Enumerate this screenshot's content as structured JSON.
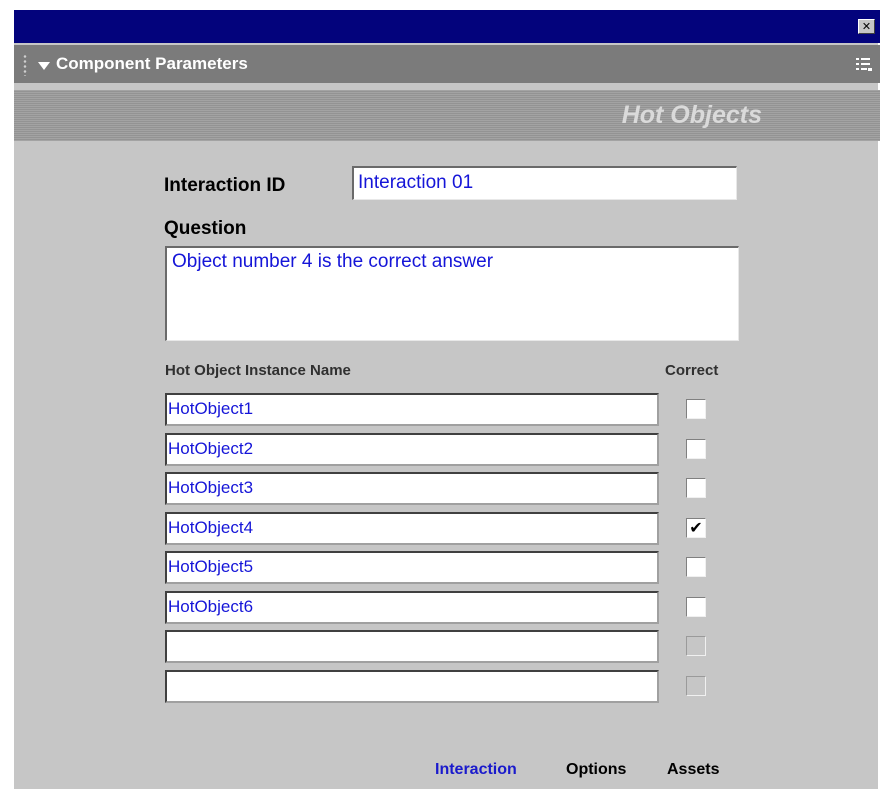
{
  "window": {
    "close_glyph": "✕"
  },
  "panel": {
    "title": "Component Parameters"
  },
  "header": {
    "title": "Hot Objects"
  },
  "form": {
    "interaction_id_label": "Interaction ID",
    "interaction_id_value": "Interaction  01",
    "question_label": "Question",
    "question_value": "Object number 4 is the correct answer",
    "instance_name_header": "Hot Object Instance Name",
    "correct_header": "Correct",
    "rows": [
      {
        "name": "HotObject1",
        "correct": false,
        "enabled": true
      },
      {
        "name": "HotObject2",
        "correct": false,
        "enabled": true
      },
      {
        "name": "HotObject3",
        "correct": false,
        "enabled": true
      },
      {
        "name": "HotObject4",
        "correct": true,
        "enabled": true
      },
      {
        "name": "HotObject5",
        "correct": false,
        "enabled": true
      },
      {
        "name": "HotObject6",
        "correct": false,
        "enabled": true
      },
      {
        "name": "",
        "correct": false,
        "enabled": false
      },
      {
        "name": "",
        "correct": false,
        "enabled": false
      }
    ]
  },
  "tabs": {
    "interaction": "Interaction",
    "options": "Options",
    "assets": "Assets"
  },
  "colors": {
    "titlebar": "#03037c",
    "panelbar": "#7b7b7b",
    "background": "#c6c6c6",
    "field_text": "#1515d8",
    "active_tab": "#1a1acc"
  },
  "icons": {
    "close": "close-icon",
    "collapse": "triangle-down-icon",
    "grip": "grip-icon",
    "menu": "panel-menu-icon",
    "check": "checkmark-icon"
  }
}
